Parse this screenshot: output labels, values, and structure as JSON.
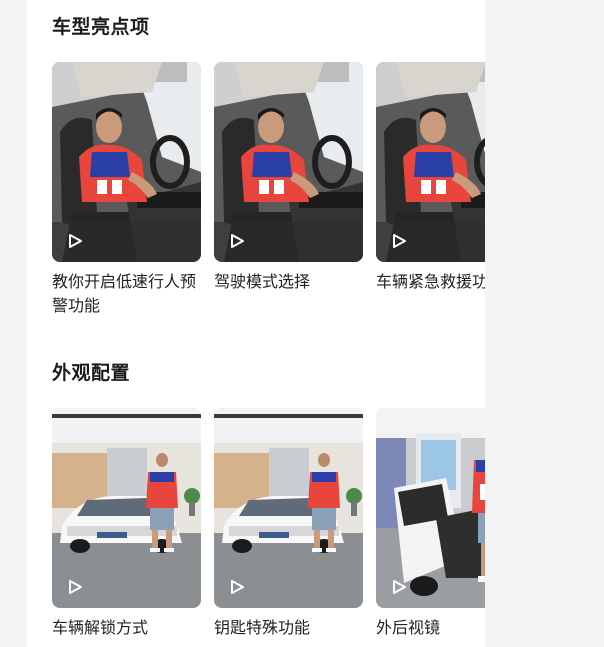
{
  "sections": [
    {
      "title": "车型亮点项",
      "cards": [
        {
          "caption": "教你开启低速行人预警功能",
          "icon": "play-icon"
        },
        {
          "caption": "驾驶模式选择",
          "icon": "play-icon"
        },
        {
          "caption": "车辆紧急救援功能",
          "icon": "play-icon"
        }
      ]
    },
    {
      "title": "外观配置",
      "cards": [
        {
          "caption": "车辆解锁方式",
          "icon": "play-icon"
        },
        {
          "caption": "钥匙特殊功能",
          "icon": "play-icon"
        },
        {
          "caption": "外后视镜",
          "icon": "play-icon"
        }
      ]
    }
  ],
  "colors": {
    "page_bg": "#ffffff",
    "outer_bg": "#f3f3f3",
    "title": "#1c1c1c",
    "caption": "#222222",
    "shirt_red": "#e8453c",
    "shirt_blue": "#2a3fa8"
  }
}
